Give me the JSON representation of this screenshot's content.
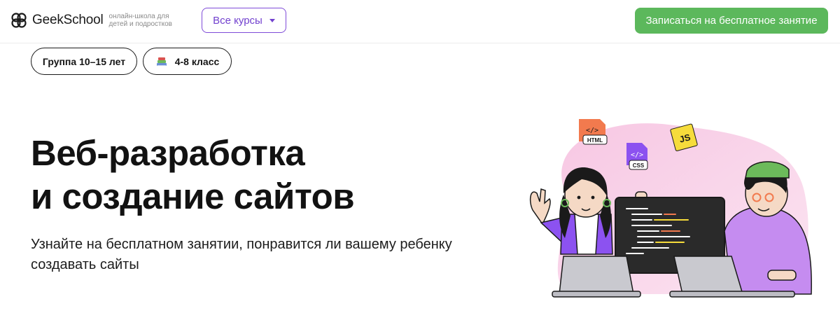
{
  "header": {
    "logo_text": "GeekSchool",
    "logo_tagline": "онлайн-школа для детей и подростков",
    "courses_label": "Все курсы",
    "cta_label": "Записаться на бесплатное занятие",
    "accent_purple": "#7f4bd8",
    "accent_green": "#5cb85c"
  },
  "tags": {
    "age_label": "Группа 10–15 лет",
    "grade_label": "4-8 класс",
    "grade_icon": "books-icon"
  },
  "hero": {
    "title_line1": "Веб-разработка",
    "title_line2": "и создание сайтов",
    "subtitle": "Узнайте на бесплатном занятии, понравится ли вашему ребенку создавать сайты"
  },
  "illustration": {
    "html_badge": "HTML",
    "css_badge": "CSS",
    "js_badge": "JS",
    "code_glyph": "</>"
  }
}
